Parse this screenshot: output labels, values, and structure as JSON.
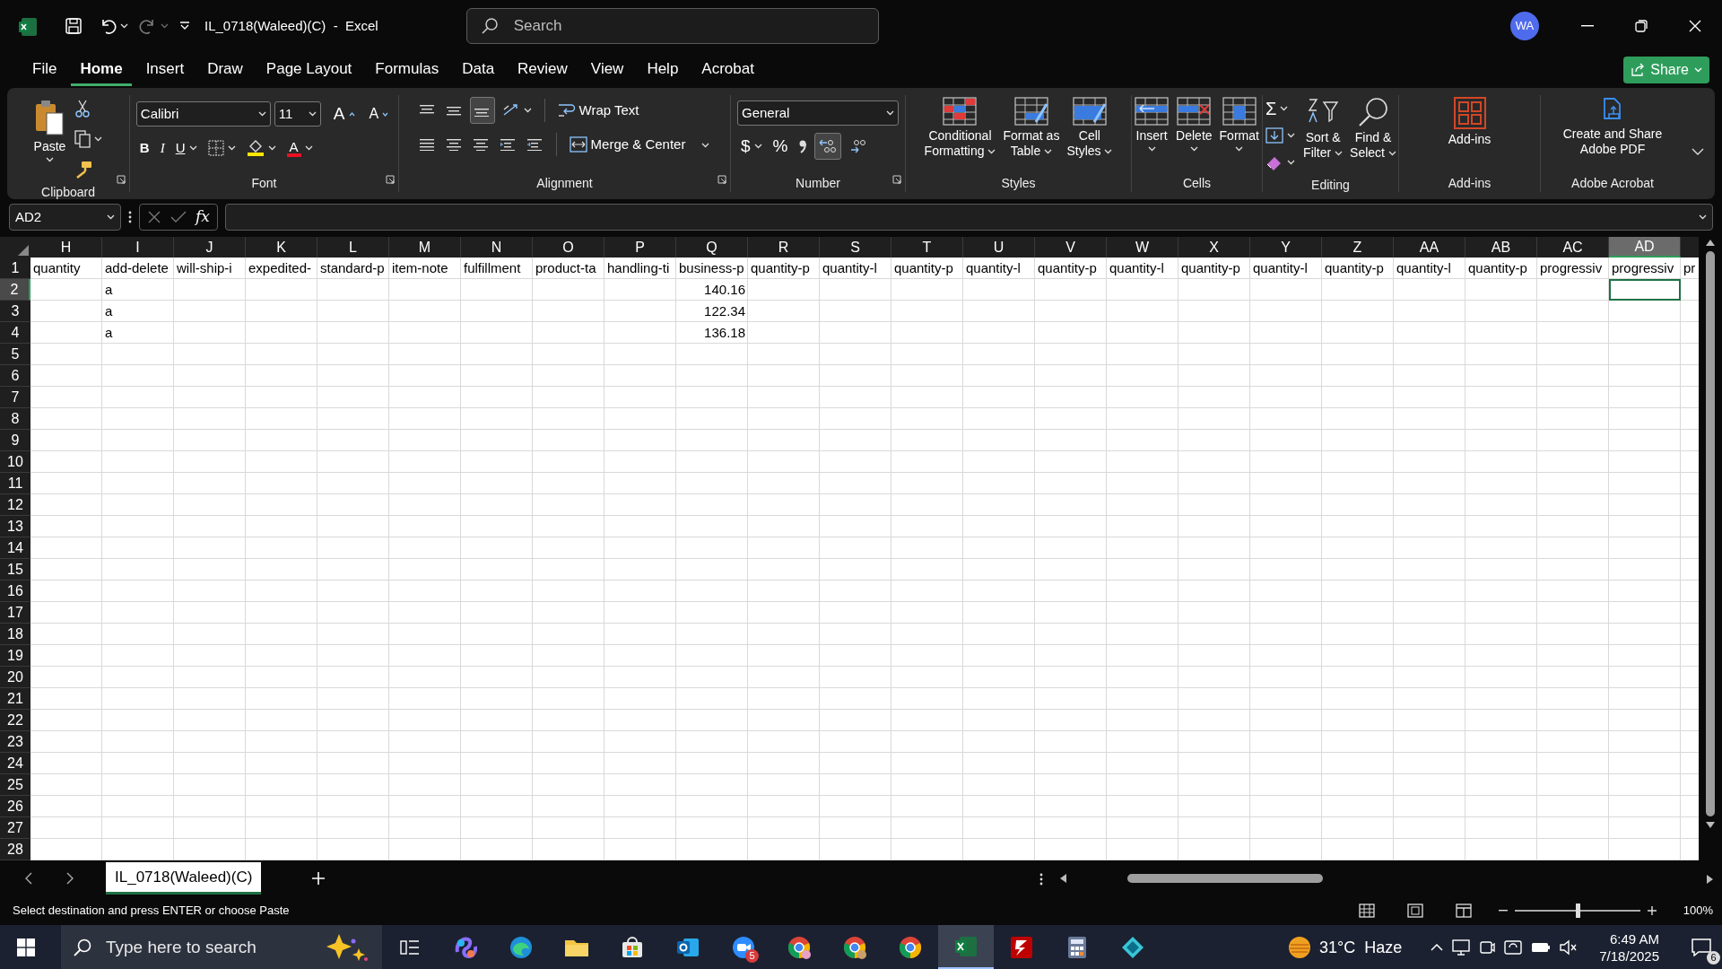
{
  "window": {
    "title": "IL_0718(Waleed)(C)  -  Excel",
    "search_placeholder": "Search",
    "account": "WA"
  },
  "menu_tabs": [
    {
      "label": "File",
      "selected": false
    },
    {
      "label": "Home",
      "selected": true
    },
    {
      "label": "Insert",
      "selected": false
    },
    {
      "label": "Draw",
      "selected": false
    },
    {
      "label": "Page Layout",
      "selected": false
    },
    {
      "label": "Formulas",
      "selected": false
    },
    {
      "label": "Data",
      "selected": false
    },
    {
      "label": "Review",
      "selected": false
    },
    {
      "label": "View",
      "selected": false
    },
    {
      "label": "Help",
      "selected": false
    },
    {
      "label": "Acrobat",
      "selected": false
    }
  ],
  "share_button": "Share",
  "ribbon": {
    "clipboard": {
      "paste": "Paste",
      "label": "Clipboard"
    },
    "font": {
      "family": "Calibri",
      "size": "11",
      "grow": "A",
      "shrink": "A",
      "bold": "B",
      "italic": "I",
      "underline": "U",
      "text_color_letter": "A",
      "label": "Font"
    },
    "alignment": {
      "wrap_text": "Wrap Text",
      "merge": "Merge & Center",
      "label": "Alignment"
    },
    "number": {
      "format": "General",
      "currency": "$",
      "percent": "%",
      "label": "Number"
    },
    "styles": {
      "conditional": [
        "Conditional",
        "Formatting"
      ],
      "format_table": [
        "Format as",
        "Table"
      ],
      "cell_styles": [
        "Cell",
        "Styles"
      ],
      "label": "Styles"
    },
    "cells": {
      "insert": "Insert",
      "delete": "Delete",
      "format": "Format",
      "label": "Cells"
    },
    "editing": {
      "sum": "Σ",
      "sort": [
        "Sort &",
        "Filter"
      ],
      "find": [
        "Find &",
        "Select"
      ],
      "label": "Editing"
    },
    "addins": {
      "addins": "Add-ins",
      "label": "Add-ins"
    },
    "acrobat": {
      "create": [
        "Create and Share",
        "Adobe PDF"
      ],
      "label": "Adobe Acrobat"
    }
  },
  "formula_bar": {
    "name_box": "AD2",
    "fx": "fx"
  },
  "columns": [
    {
      "letter": "H",
      "selected": false
    },
    {
      "letter": "I",
      "selected": false
    },
    {
      "letter": "J",
      "selected": false
    },
    {
      "letter": "K",
      "selected": false
    },
    {
      "letter": "L",
      "selected": false
    },
    {
      "letter": "M",
      "selected": false
    },
    {
      "letter": "N",
      "selected": false
    },
    {
      "letter": "O",
      "selected": false
    },
    {
      "letter": "P",
      "selected": false
    },
    {
      "letter": "Q",
      "selected": false
    },
    {
      "letter": "R",
      "selected": false
    },
    {
      "letter": "S",
      "selected": false
    },
    {
      "letter": "T",
      "selected": false
    },
    {
      "letter": "U",
      "selected": false
    },
    {
      "letter": "V",
      "selected": false
    },
    {
      "letter": "W",
      "selected": false
    },
    {
      "letter": "X",
      "selected": false
    },
    {
      "letter": "Y",
      "selected": false
    },
    {
      "letter": "Z",
      "selected": false
    },
    {
      "letter": "AA",
      "selected": false
    },
    {
      "letter": "AB",
      "selected": false
    },
    {
      "letter": "AC",
      "selected": false
    },
    {
      "letter": "AD",
      "selected": true
    }
  ],
  "rows": [
    {
      "number": "1",
      "selected": false,
      "cells": {
        "H": {
          "text": "quantity",
          "kind": "text"
        },
        "I": {
          "text": "add-delete",
          "kind": "text"
        },
        "J": {
          "text": "will-ship-i",
          "kind": "text"
        },
        "K": {
          "text": "expedited-",
          "kind": "text"
        },
        "L": {
          "text": "standard-p",
          "kind": "text"
        },
        "M": {
          "text": "item-note",
          "kind": "text"
        },
        "N": {
          "text": "fulfillment",
          "kind": "text"
        },
        "O": {
          "text": "product-ta",
          "kind": "text"
        },
        "P": {
          "text": "handling-ti",
          "kind": "text"
        },
        "Q": {
          "text": "business-p",
          "kind": "text"
        },
        "R": {
          "text": "quantity-p",
          "kind": "text"
        },
        "S": {
          "text": "quantity-l",
          "kind": "text"
        },
        "T": {
          "text": "quantity-p",
          "kind": "text"
        },
        "U": {
          "text": "quantity-l",
          "kind": "text"
        },
        "V": {
          "text": "quantity-p",
          "kind": "text"
        },
        "W": {
          "text": "quantity-l",
          "kind": "text"
        },
        "X": {
          "text": "quantity-p",
          "kind": "text"
        },
        "Y": {
          "text": "quantity-l",
          "kind": "text"
        },
        "Z": {
          "text": "quantity-p",
          "kind": "text"
        },
        "AA": {
          "text": "quantity-l",
          "kind": "text"
        },
        "AB": {
          "text": "quantity-p",
          "kind": "text"
        },
        "AC": {
          "text": "progressiv",
          "kind": "text"
        },
        "AD": {
          "text": "progressiv",
          "kind": "text"
        },
        "AE": {
          "text": "pr",
          "kind": "text"
        }
      }
    },
    {
      "number": "2",
      "selected": true,
      "cells": {
        "I": {
          "text": "a",
          "kind": "text"
        },
        "Q": {
          "text": "140.16",
          "kind": "number"
        }
      }
    },
    {
      "number": "3",
      "selected": false,
      "cells": {
        "I": {
          "text": "a",
          "kind": "text"
        },
        "Q": {
          "text": "122.34",
          "kind": "number"
        }
      }
    },
    {
      "number": "4",
      "selected": false,
      "cells": {
        "I": {
          "text": "a",
          "kind": "text"
        },
        "Q": {
          "text": "136.18",
          "kind": "number"
        }
      }
    },
    {
      "number": "5",
      "selected": false
    },
    {
      "number": "6",
      "selected": false
    },
    {
      "number": "7",
      "selected": false
    },
    {
      "number": "8",
      "selected": false
    },
    {
      "number": "9",
      "selected": false
    },
    {
      "number": "10",
      "selected": false
    },
    {
      "number": "11",
      "selected": false
    },
    {
      "number": "12",
      "selected": false
    },
    {
      "number": "13",
      "selected": false
    },
    {
      "number": "14",
      "selected": false
    },
    {
      "number": "15",
      "selected": false
    },
    {
      "number": "16",
      "selected": false
    },
    {
      "number": "17",
      "selected": false
    },
    {
      "number": "18",
      "selected": false
    },
    {
      "number": "19",
      "selected": false
    },
    {
      "number": "20",
      "selected": false
    },
    {
      "number": "21",
      "selected": false
    },
    {
      "number": "22",
      "selected": false
    },
    {
      "number": "23",
      "selected": false
    },
    {
      "number": "24",
      "selected": false
    },
    {
      "number": "25",
      "selected": false
    },
    {
      "number": "26",
      "selected": false
    },
    {
      "number": "27",
      "selected": false
    },
    {
      "number": "28",
      "selected": false
    }
  ],
  "sheet_tabs": [
    {
      "label": "IL_0718(Waleed)(C)",
      "selected": true
    }
  ],
  "status_bar": {
    "message": "Select destination and press ENTER or choose Paste",
    "zoom": "100%",
    "zoom_slider": {
      "level": 0.5
    }
  },
  "taskbar": {
    "search_placeholder": "Type here to search",
    "apps": [
      {
        "selected": false
      },
      {
        "selected": false
      },
      {
        "selected": false
      },
      {
        "selected": false
      },
      {
        "selected": false
      },
      {
        "selected": false
      },
      {
        "selected": false,
        "badge": "5"
      },
      {
        "selected": false
      },
      {
        "selected": false
      },
      {
        "selected": false
      },
      {
        "selected": true
      },
      {
        "selected": false
      },
      {
        "selected": false
      },
      {
        "selected": false
      }
    ],
    "weather": "31°C  Haze",
    "time": "6:49 AM",
    "date": "7/18/2025",
    "notifications": "6"
  }
}
